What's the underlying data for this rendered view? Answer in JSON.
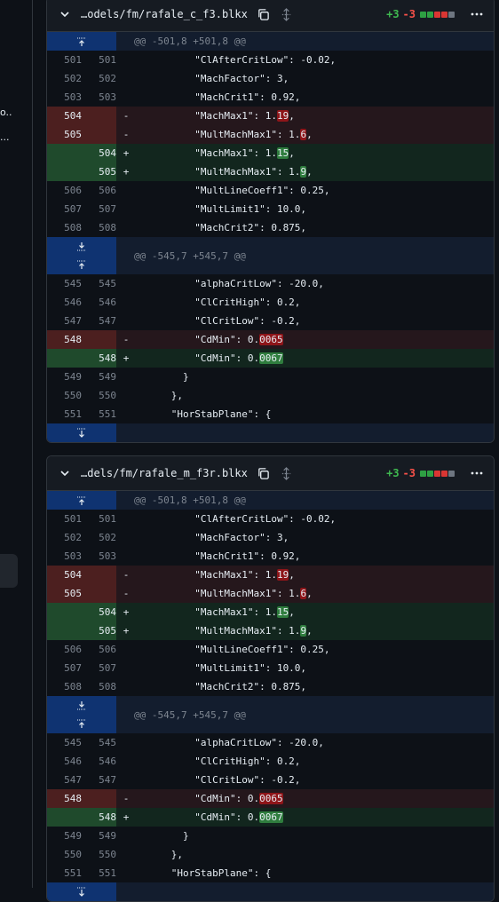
{
  "sidebar": {
    "fragments": [
      "o...",
      "..."
    ]
  },
  "files": [
    {
      "filename": "…odels/fm/rafale_c_f3.blkx",
      "additions": "+3",
      "deletions": "-3",
      "hunks": [
        {
          "header": "@@ -501,8 +501,8 @@",
          "lines": [
            {
              "type": "ctx",
              "old": "501",
              "new": "501",
              "code": "          \"ClAfterCritLow\": -0.02,"
            },
            {
              "type": "ctx",
              "old": "502",
              "new": "502",
              "code": "          \"MachFactor\": 3,"
            },
            {
              "type": "ctx",
              "old": "503",
              "new": "503",
              "code": "          \"MachCrit1\": 0.92,"
            },
            {
              "type": "del",
              "old": "504",
              "new": "",
              "pre": "          \"MachMax1\": 1.",
              "hl": "19",
              "post": ","
            },
            {
              "type": "del",
              "old": "505",
              "new": "",
              "pre": "          \"MultMachMax1\": 1.",
              "hl": "6",
              "post": ","
            },
            {
              "type": "add",
              "old": "",
              "new": "504",
              "pre": "          \"MachMax1\": 1.",
              "hl": "15",
              "post": ","
            },
            {
              "type": "add",
              "old": "",
              "new": "505",
              "pre": "          \"MultMachMax1\": 1.",
              "hl": "9",
              "post": ","
            },
            {
              "type": "ctx",
              "old": "506",
              "new": "506",
              "code": "          \"MultLineCoeff1\": 0.25,"
            },
            {
              "type": "ctx",
              "old": "507",
              "new": "507",
              "code": "          \"MultLimit1\": 10.0,"
            },
            {
              "type": "ctx",
              "old": "508",
              "new": "508",
              "code": "          \"MachCrit2\": 0.875,"
            }
          ]
        },
        {
          "header": "@@ -545,7 +545,7 @@",
          "lines": [
            {
              "type": "ctx",
              "old": "545",
              "new": "545",
              "code": "          \"alphaCritLow\": -20.0,"
            },
            {
              "type": "ctx",
              "old": "546",
              "new": "546",
              "code": "          \"ClCritHigh\": 0.2,"
            },
            {
              "type": "ctx",
              "old": "547",
              "new": "547",
              "code": "          \"ClCritLow\": -0.2,"
            },
            {
              "type": "del",
              "old": "548",
              "new": "",
              "pre": "          \"CdMin\": 0.",
              "hl": "0065",
              "post": ""
            },
            {
              "type": "add",
              "old": "",
              "new": "548",
              "pre": "          \"CdMin\": 0.",
              "hl": "0067",
              "post": ""
            },
            {
              "type": "ctx",
              "old": "549",
              "new": "549",
              "code": "        }"
            },
            {
              "type": "ctx",
              "old": "550",
              "new": "550",
              "code": "      },"
            },
            {
              "type": "ctx",
              "old": "551",
              "new": "551",
              "code": "      \"HorStabPlane\": {"
            }
          ]
        }
      ]
    },
    {
      "filename": "…dels/fm/rafale_m_f3r.blkx",
      "additions": "+3",
      "deletions": "-3",
      "hunks": [
        {
          "header": "@@ -501,8 +501,8 @@",
          "lines": [
            {
              "type": "ctx",
              "old": "501",
              "new": "501",
              "code": "          \"ClAfterCritLow\": -0.02,"
            },
            {
              "type": "ctx",
              "old": "502",
              "new": "502",
              "code": "          \"MachFactor\": 3,"
            },
            {
              "type": "ctx",
              "old": "503",
              "new": "503",
              "code": "          \"MachCrit1\": 0.92,"
            },
            {
              "type": "del",
              "old": "504",
              "new": "",
              "pre": "          \"MachMax1\": 1.",
              "hl": "19",
              "post": ","
            },
            {
              "type": "del",
              "old": "505",
              "new": "",
              "pre": "          \"MultMachMax1\": 1.",
              "hl": "6",
              "post": ","
            },
            {
              "type": "add",
              "old": "",
              "new": "504",
              "pre": "          \"MachMax1\": 1.",
              "hl": "15",
              "post": ","
            },
            {
              "type": "add",
              "old": "",
              "new": "505",
              "pre": "          \"MultMachMax1\": 1.",
              "hl": "9",
              "post": ","
            },
            {
              "type": "ctx",
              "old": "506",
              "new": "506",
              "code": "          \"MultLineCoeff1\": 0.25,"
            },
            {
              "type": "ctx",
              "old": "507",
              "new": "507",
              "code": "          \"MultLimit1\": 10.0,"
            },
            {
              "type": "ctx",
              "old": "508",
              "new": "508",
              "code": "          \"MachCrit2\": 0.875,"
            }
          ]
        },
        {
          "header": "@@ -545,7 +545,7 @@",
          "lines": [
            {
              "type": "ctx",
              "old": "545",
              "new": "545",
              "code": "          \"alphaCritLow\": -20.0,"
            },
            {
              "type": "ctx",
              "old": "546",
              "new": "546",
              "code": "          \"ClCritHigh\": 0.2,"
            },
            {
              "type": "ctx",
              "old": "547",
              "new": "547",
              "code": "          \"ClCritLow\": -0.2,"
            },
            {
              "type": "del",
              "old": "548",
              "new": "",
              "pre": "          \"CdMin\": 0.",
              "hl": "0065",
              "post": ""
            },
            {
              "type": "add",
              "old": "",
              "new": "548",
              "pre": "          \"CdMin\": 0.",
              "hl": "0067",
              "post": ""
            },
            {
              "type": "ctx",
              "old": "549",
              "new": "549",
              "code": "        }"
            },
            {
              "type": "ctx",
              "old": "550",
              "new": "550",
              "code": "      },"
            },
            {
              "type": "ctx",
              "old": "551",
              "new": "551",
              "code": "      \"HorStabPlane\": {"
            }
          ]
        }
      ]
    }
  ]
}
